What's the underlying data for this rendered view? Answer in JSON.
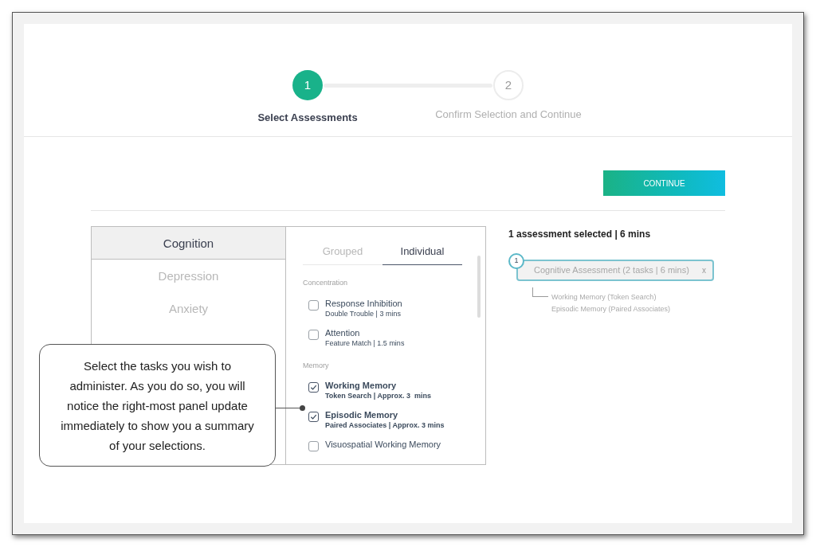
{
  "stepper": {
    "steps": [
      {
        "number": "1",
        "label": "Select Assessments",
        "selected": true
      },
      {
        "number": "2",
        "label": "Confirm Selection and Continue",
        "selected": false
      }
    ]
  },
  "continue_button": "CONTINUE",
  "categories": [
    {
      "label": "Cognition",
      "selected": true
    },
    {
      "label": "Depression",
      "selected": false
    },
    {
      "label": "Anxiety",
      "selected": false
    }
  ],
  "view_tabs": [
    {
      "label": "Grouped",
      "selected": false
    },
    {
      "label": "Individual",
      "selected": true
    }
  ],
  "task_groups": [
    {
      "heading": "Concentration",
      "tasks": [
        {
          "name": "Response Inhibition",
          "detail": "Double Trouble | 3 mins",
          "checked": false
        },
        {
          "name": "Attention",
          "detail": "Feature Match | 1.5 mins",
          "checked": false
        }
      ]
    },
    {
      "heading": "Memory",
      "tasks": [
        {
          "name": "Working Memory",
          "detail": "Token Search | Approx. 3  mins",
          "checked": true
        },
        {
          "name": "Episodic Memory",
          "detail": "Paired Associates | Approx. 3 mins",
          "checked": true
        },
        {
          "name": "Visuospatial Working Memory",
          "checked": false
        }
      ]
    }
  ],
  "callout": "Select the tasks you wish to administer. As you do so, you will notice the right-most panel update immediately to show you a summary of your selections.",
  "summary": {
    "title": "1 assessment selected | 6 mins",
    "assessments": [
      {
        "number": "1",
        "label": "Cognitive Assessment (2 tasks | 6 mins)",
        "remove": "x",
        "tasks": [
          "Working Memory (Token Search)",
          "Episodic Memory (Paired Associates)"
        ]
      }
    ]
  }
}
